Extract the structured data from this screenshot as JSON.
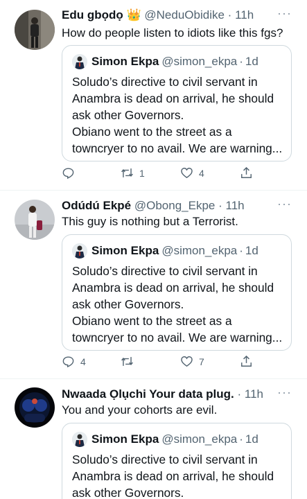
{
  "tweets": [
    {
      "name": "Edu gbọdọ 👑",
      "handle": "@NeduObidike",
      "dot": "·",
      "time": "11h",
      "text": "How do people listen to idiots like this fgs?",
      "quote": {
        "name": "Simon Ekpa",
        "handle": "@simon_ekpa",
        "dot": "·",
        "time": "1d",
        "lines": [
          "Soludo’s directive to civil servant in",
          "Anambra is dead on arrival, he should",
          "ask other Governors.",
          "Obiano went to the street as a",
          "towncryer to no avail. We are warning..."
        ]
      },
      "reply_count": "",
      "retweet_count": "1",
      "like_count": "4"
    },
    {
      "name": "Odúdú Ekpé",
      "handle": "@Obong_Ekpe",
      "dot": "·",
      "time": "11h",
      "text": "This guy is nothing but a Terrorist.",
      "quote": {
        "name": "Simon Ekpa",
        "handle": "@simon_ekpa",
        "dot": "·",
        "time": "1d",
        "lines": [
          "Soludo’s directive to civil servant in",
          "Anambra is dead on arrival, he should",
          "ask other Governors.",
          "Obiano went to the street as a",
          "towncryer to no avail. We are warning..."
        ]
      },
      "reply_count": "4",
      "retweet_count": "",
      "like_count": "7"
    },
    {
      "name": "Nwaada Ọlụchi Your data plug.",
      "handle": "",
      "dot": "·",
      "time": "11h",
      "text": "You and your cohorts are evil.",
      "quote": {
        "name": "Simon Ekpa",
        "handle": "@simon_ekpa",
        "dot": "·",
        "time": "1d",
        "lines": [
          "Soludo’s directive to civil servant in",
          "Anambra is dead on arrival, he should",
          "ask other Governors."
        ]
      }
    }
  ],
  "more_glyph": "···",
  "icons": [
    "more-icon",
    "reply-icon",
    "retweet-icon",
    "like-icon",
    "share-icon"
  ],
  "colors": {
    "text": "#0f1419",
    "secondary": "#536471",
    "border": "#cfd9de",
    "divider": "#eff3f4"
  }
}
